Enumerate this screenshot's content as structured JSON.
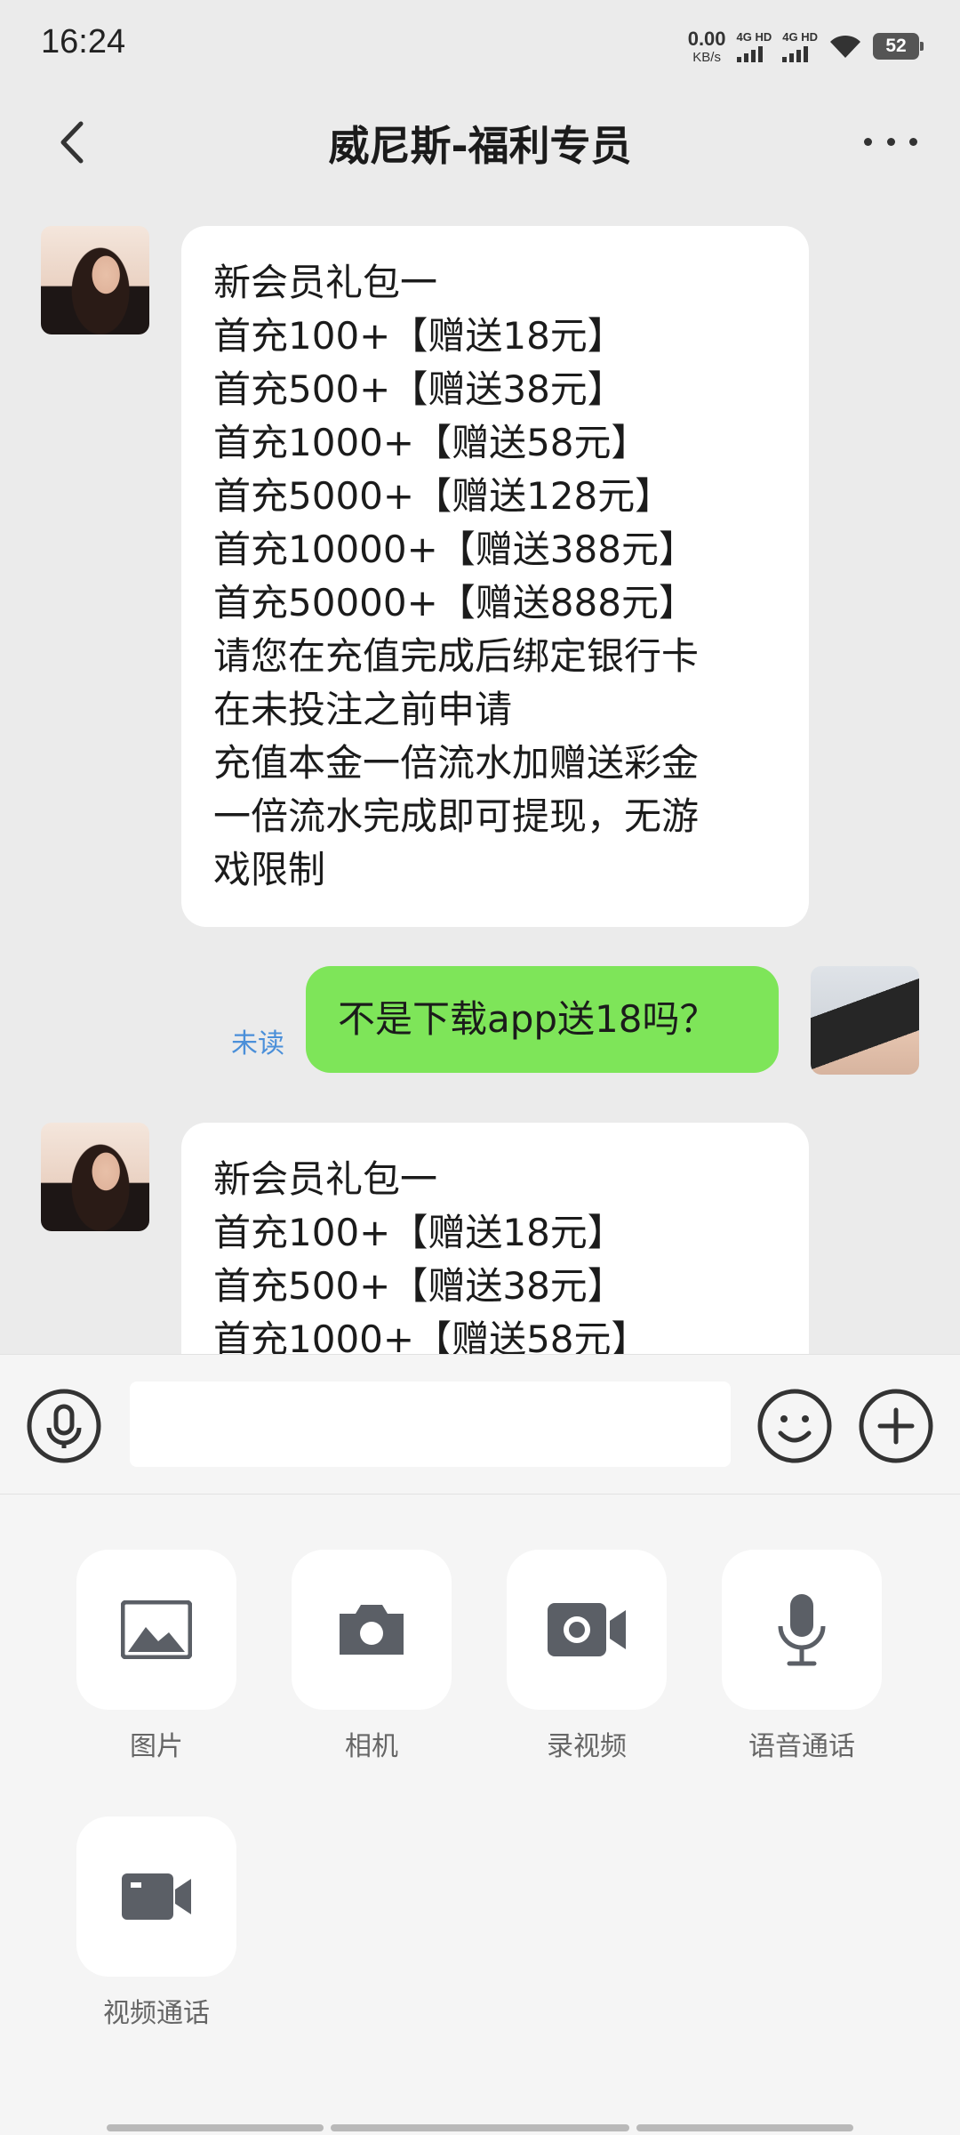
{
  "status_bar": {
    "time": "16:24",
    "net_speed_value": "0.00",
    "net_speed_unit": "KB/s",
    "sim1_label": "4G HD",
    "sim2_label": "4G HD",
    "battery": "52"
  },
  "header": {
    "title": "威尼斯-福利专员",
    "back_icon": "chevron-left-icon",
    "more_icon": "more-dots-icon"
  },
  "messages": [
    {
      "direction": "incoming",
      "text": "新会员礼包一\n首充100+【赠送18元】\n首充500+【赠送38元】\n首充1000+【赠送58元】\n首充5000+【赠送128元】\n首充10000+【赠送388元】\n首充50000+【赠送888元】\n请您在充值完成后绑定银行卡\n在未投注之前申请\n充值本金一倍流水加赠送彩金\n一倍流水完成即可提现，无游\n戏限制"
    },
    {
      "direction": "outgoing",
      "status": "未读",
      "text": "不是下载app送18吗？"
    },
    {
      "direction": "incoming",
      "text": "新会员礼包一\n首充100+【赠送18元】\n首充500+【赠送38元】\n首充1000+【赠送58元】"
    }
  ],
  "input_bar": {
    "placeholder": "",
    "voice_icon": "microphone-icon",
    "emoji_icon": "smiley-icon",
    "plus_icon": "plus-icon"
  },
  "tools": [
    {
      "label": "图片",
      "icon": "image-icon"
    },
    {
      "label": "相机",
      "icon": "camera-icon"
    },
    {
      "label": "录视频",
      "icon": "video-record-icon"
    },
    {
      "label": "语音通话",
      "icon": "microphone-icon"
    },
    {
      "label": "视频通话",
      "icon": "video-camera-icon"
    }
  ],
  "colors": {
    "background": "#ebebeb",
    "incoming_bubble": "#ffffff",
    "outgoing_bubble": "#7ee559",
    "unread_text": "#4a8fd9",
    "icon": "#5b5f66"
  }
}
